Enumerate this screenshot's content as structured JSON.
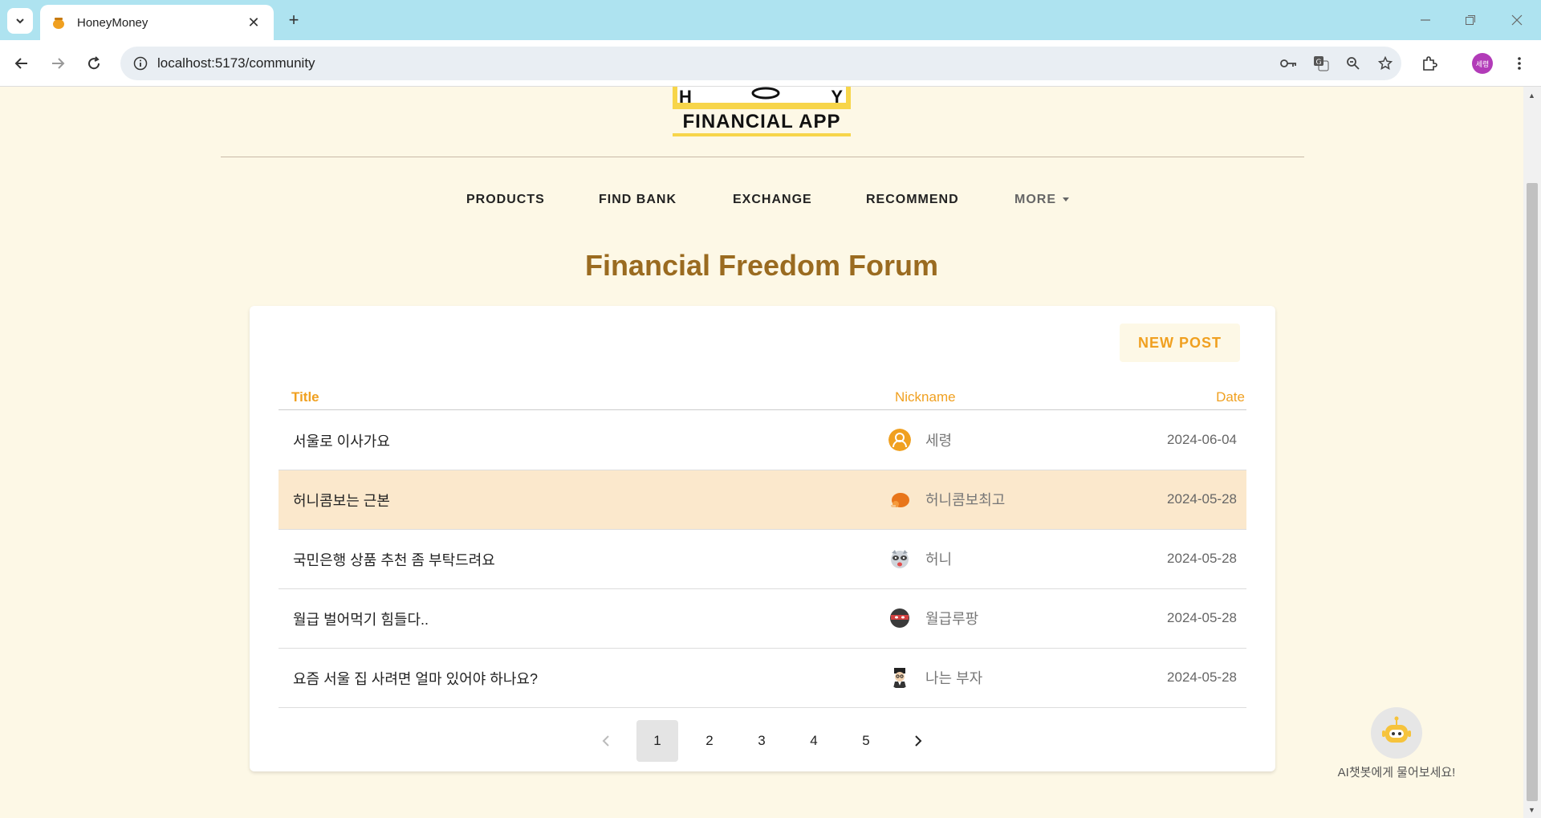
{
  "browser": {
    "tab_title": "HoneyMoney",
    "url": "localhost:5173/community",
    "profile_label": "세령"
  },
  "logo": {
    "text": "FINANCIAL APP"
  },
  "nav": {
    "items": [
      "PRODUCTS",
      "FIND BANK",
      "EXCHANGE",
      "RECOMMEND"
    ],
    "more_label": "MORE"
  },
  "forum": {
    "title": "Financial Freedom Forum",
    "new_post_label": "NEW POST",
    "columns": {
      "title": "Title",
      "nickname": "Nickname",
      "date": "Date"
    },
    "posts": [
      {
        "title": "서울로 이사가요",
        "nickname": "세령",
        "date": "2024-06-04",
        "avatar": "user-icon"
      },
      {
        "title": "허니콤보는 근본",
        "nickname": "허니콤보최고",
        "date": "2024-05-28",
        "avatar": "chicken-icon"
      },
      {
        "title": "국민은행 상품 추천 좀 부탁드려요",
        "nickname": "허니",
        "date": "2024-05-28",
        "avatar": "raccoon-icon"
      },
      {
        "title": "월급 벌어먹기 힘들다..",
        "nickname": "월급루팡",
        "date": "2024-05-28",
        "avatar": "ninja-icon"
      },
      {
        "title": "요즘 서울 집 사려면 얼마 있어야 하나요?",
        "nickname": "나는 부자",
        "date": "2024-05-28",
        "avatar": "rich-man-icon"
      }
    ],
    "pagination": {
      "pages": [
        "1",
        "2",
        "3",
        "4",
        "5"
      ],
      "current": "1"
    }
  },
  "chatbot": {
    "label": "AI챗봇에게 물어보세요!"
  },
  "colors": {
    "accent": "#f0a020",
    "title": "#9a6b20",
    "background": "#fdf8e6",
    "row_hover": "#fbe8cc"
  }
}
